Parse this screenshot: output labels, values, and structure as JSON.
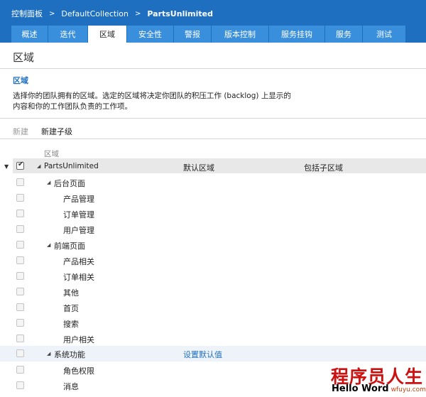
{
  "breadcrumb": {
    "items": [
      "控制面板",
      "DefaultCollection",
      "PartsUnlimited"
    ],
    "separator": ">"
  },
  "tabs": [
    {
      "label": "概述",
      "active": false
    },
    {
      "label": "迭代",
      "active": false
    },
    {
      "label": "区域",
      "active": true
    },
    {
      "label": "安全性",
      "active": false
    },
    {
      "label": "警报",
      "active": false
    },
    {
      "label": "版本控制",
      "active": false
    },
    {
      "label": "服务挂钩",
      "active": false
    },
    {
      "label": "服务",
      "active": false
    },
    {
      "label": "测试",
      "active": false
    }
  ],
  "page": {
    "title": "区域",
    "section_title": "区域",
    "description": "选择你的团队拥有的区域。选定的区域将决定你团队的积压工作 (backlog) 上显示的内容和你的工作团队负责的工作项。"
  },
  "toolbar": {
    "new_label": "新建",
    "new_child_label": "新建子级"
  },
  "grid": {
    "caption": "区域",
    "columns": [
      "PartsUnlimited",
      "默认区域",
      "包括子区域"
    ],
    "rows": [
      {
        "label": "后台页面",
        "level": 1,
        "expandable": true
      },
      {
        "label": "产品管理",
        "level": 2,
        "expandable": false
      },
      {
        "label": "订单管理",
        "level": 2,
        "expandable": false
      },
      {
        "label": "用户管理",
        "level": 2,
        "expandable": false
      },
      {
        "label": "前端页面",
        "level": 1,
        "expandable": true
      },
      {
        "label": "产品相关",
        "level": 2,
        "expandable": false
      },
      {
        "label": "订单相关",
        "level": 2,
        "expandable": false
      },
      {
        "label": "其他",
        "level": 2,
        "expandable": false
      },
      {
        "label": "首页",
        "level": 2,
        "expandable": false
      },
      {
        "label": "搜索",
        "level": 2,
        "expandable": false
      },
      {
        "label": "用户相关",
        "level": 2,
        "expandable": false
      },
      {
        "label": "系统功能",
        "level": 1,
        "expandable": true,
        "hovered": true,
        "action": "设置默认值"
      },
      {
        "label": "角色权限",
        "level": 2,
        "expandable": false
      },
      {
        "label": "消息",
        "level": 2,
        "expandable": false
      }
    ]
  },
  "watermark": {
    "title": "程序员人生",
    "subtitle": "Hello Word",
    "site": "wfuyu.com"
  },
  "colors": {
    "header_bg": "#1e6fc0",
    "tab_bg": "#3a8fdc",
    "link": "#1e6fc0",
    "watermark_red": "#cc1111"
  }
}
